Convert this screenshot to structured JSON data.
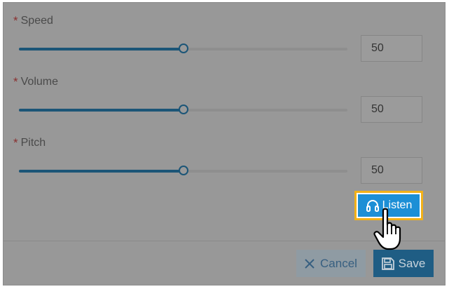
{
  "form": {
    "fields": [
      {
        "label": "Speed",
        "value": "50",
        "level": 0.5
      },
      {
        "label": "Volume",
        "value": "50",
        "level": 0.5
      },
      {
        "label": "Pitch",
        "value": "50",
        "level": 0.5
      }
    ],
    "required_mark": "*"
  },
  "buttons": {
    "listen_label": "Listen",
    "cancel_label": "Cancel",
    "save_label": "Save"
  },
  "colors": {
    "overlay": "#989898",
    "slider_track": "#1b5577",
    "listen_bg": "#1c8fd6",
    "highlight_border": "#f2b118",
    "save_bg": "#1f5d84",
    "cancel_text": "#375f80"
  },
  "icons": {
    "listen": "headphones-icon",
    "cancel": "close-icon",
    "save": "floppy-disk-icon",
    "pointer": "hand-pointer-cursor-icon"
  }
}
